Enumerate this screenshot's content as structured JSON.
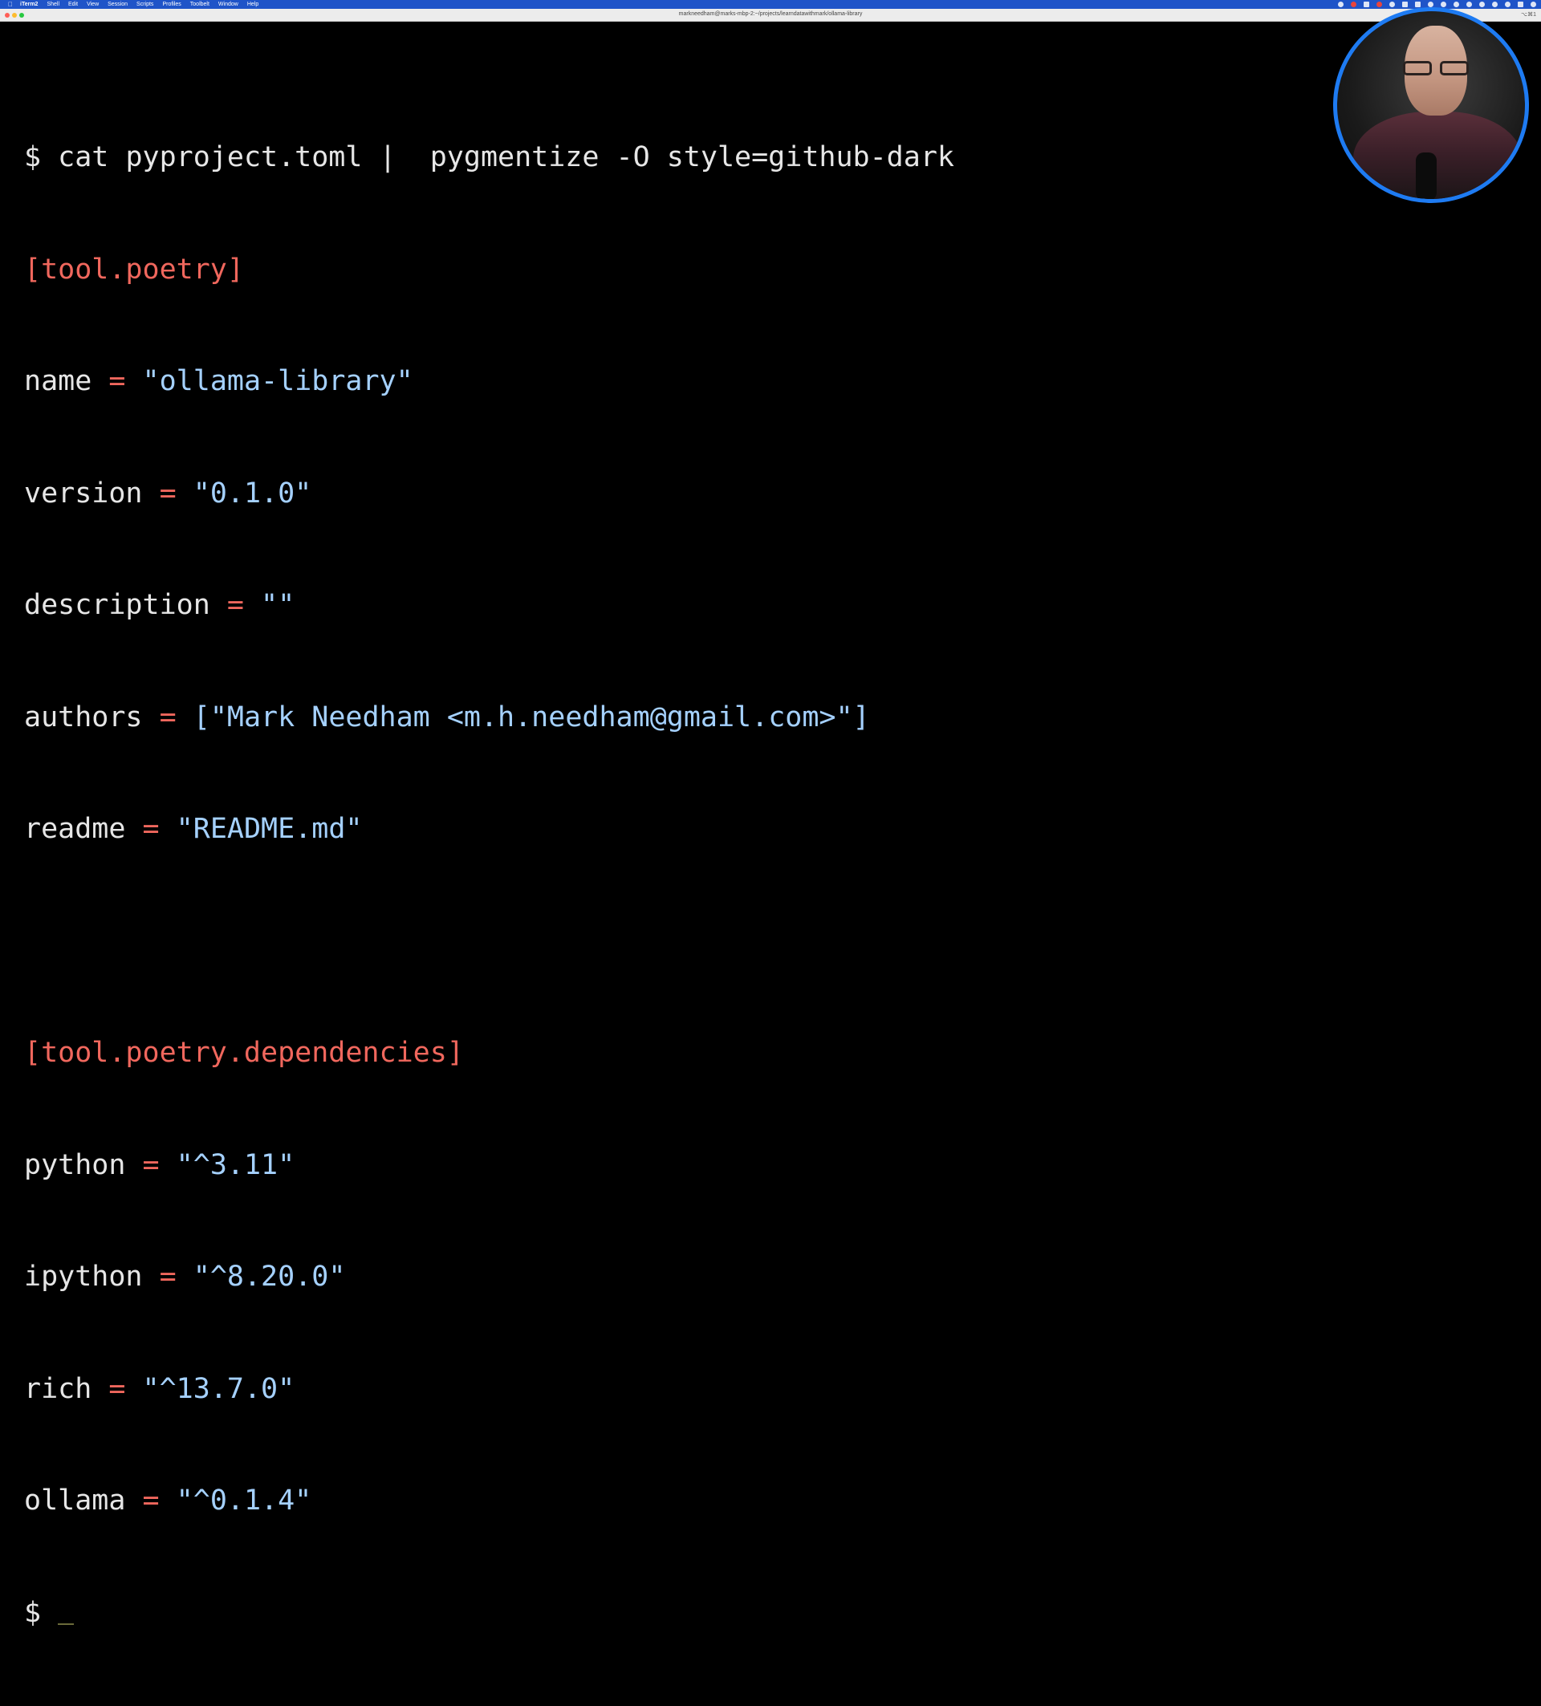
{
  "menubar": {
    "app_name": "iTerm2",
    "items": [
      "Shell",
      "Edit",
      "View",
      "Session",
      "Scripts",
      "Profiles",
      "Toolbelt",
      "Window",
      "Help"
    ]
  },
  "window": {
    "title": "markneedham@marks-mbp-2:~/projects/learndatawithmark/ollama-library",
    "shortcut": "⌥⌘1"
  },
  "terminal": {
    "command_prompt": "$ ",
    "command": "cat pyproject.toml |  pygmentize -O style=github-dark",
    "section1": "[tool.poetry]",
    "name_key": "name",
    "name_value": "\"ollama-library\"",
    "version_key": "version",
    "version_value": "\"0.1.0\"",
    "description_key": "description",
    "description_value": "\"\"",
    "authors_key": "authors",
    "authors_value": "[\"Mark Needham <m.h.needham@gmail.com>\"]",
    "readme_key": "readme",
    "readme_value": "\"README.md\"",
    "section2": "[tool.poetry.dependencies]",
    "python_key": "python",
    "python_value": "\"^3.11\"",
    "ipython_key": "ipython",
    "ipython_value": "\"^8.20.0\"",
    "rich_key": "rich",
    "rich_value": "\"^13.7.0\"",
    "ollama_key": "ollama",
    "ollama_value": "\"^0.1.4\"",
    "final_prompt": "$ ",
    "operator": "="
  },
  "colors": {
    "accent_ring": "#1e7bf2",
    "section": "#f0675d",
    "string": "#a5d1ff",
    "plain": "#e6e6e6",
    "menubar": "#1f54c8"
  }
}
